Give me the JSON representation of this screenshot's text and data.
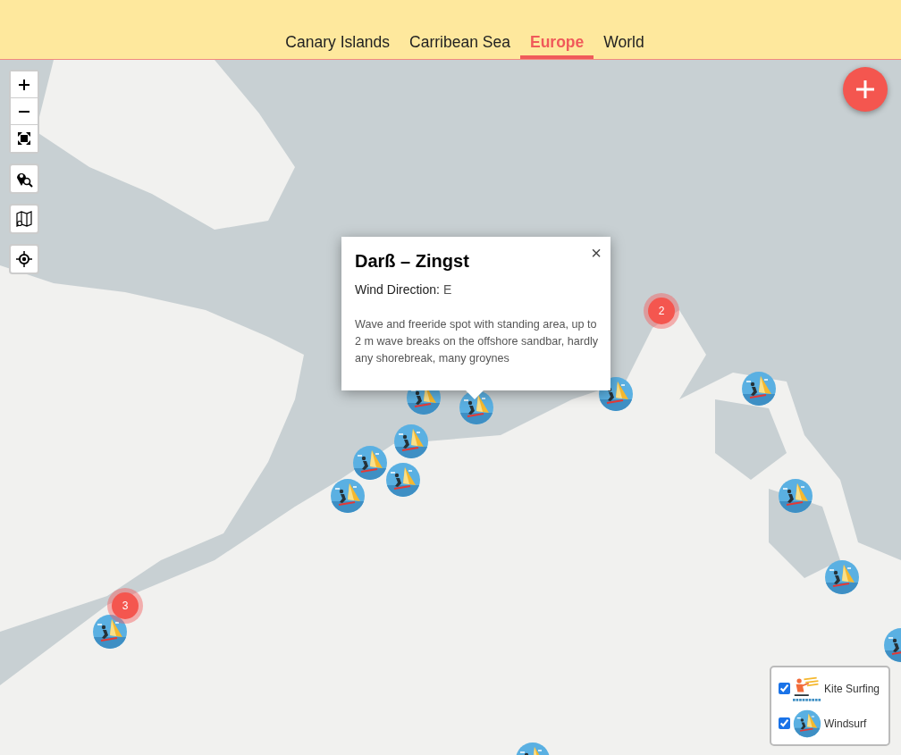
{
  "tabs": [
    {
      "label": "Canary Islands",
      "selected": false
    },
    {
      "label": "Carribean Sea",
      "selected": false
    },
    {
      "label": "Europe",
      "selected": true
    },
    {
      "label": "World",
      "selected": false
    }
  ],
  "clusters": [
    {
      "count": "2"
    },
    {
      "count": "3"
    }
  ],
  "popup": {
    "title": "Darß – Zingst",
    "wind_label": "Wind Direction:",
    "wind_value": "E",
    "description": "Wave and freeride spot with standing area, up to 2 m wave breaks on the offshore sandbar, hardly any shorebreak, many groynes",
    "close": "×"
  },
  "legend": [
    {
      "kind": "kite",
      "label": "Kite Surfing",
      "checked": true
    },
    {
      "kind": "windsurf",
      "label": "Windsurf",
      "checked": true
    }
  ]
}
